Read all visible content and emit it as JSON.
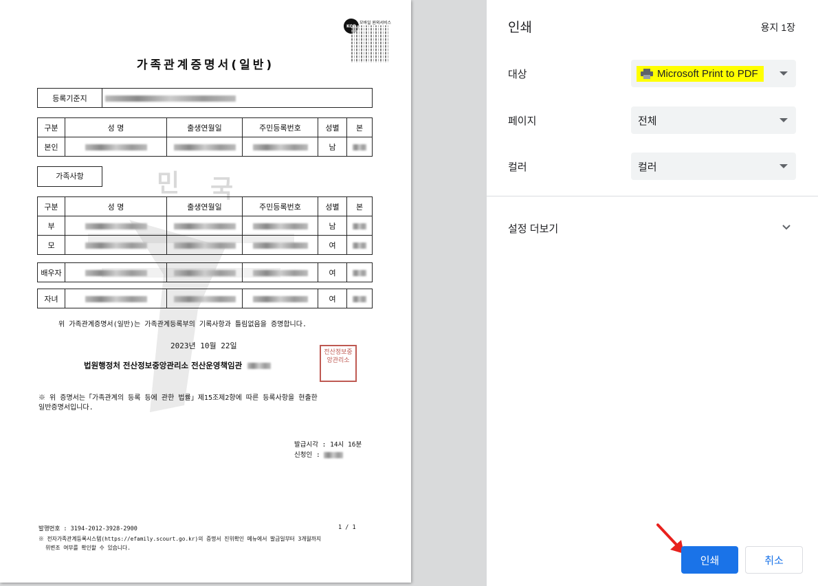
{
  "document": {
    "logo_text": "KOR",
    "service_label": "모바일 원외서비스",
    "title": "가족관계증명서(일반)",
    "registration_label": "등록기준지",
    "family_section_label": "가족사항",
    "headers": [
      "구분",
      "성 명",
      "출생연월일",
      "주민등록번호",
      "성별",
      "본"
    ],
    "self_row": {
      "kind": "본인",
      "gender": "남"
    },
    "family_rows": [
      {
        "kind": "부",
        "gender": "남"
      },
      {
        "kind": "모",
        "gender": "여"
      },
      {
        "kind": "배우자",
        "gender": "여"
      },
      {
        "kind": "자녀",
        "gender": "여"
      }
    ],
    "certify_text": "위 가족관계증명서(일반)는 가족관계등록부의 기록사항과 틀림없음을 증명합니다.",
    "date": "2023년 10월 22일",
    "issuer": "법원행정처 전산정보중앙관리소 전산운영책임관",
    "seal_text": "전산정보중앙관리소",
    "note_line1": "※ 위 증명서는「가족관계의 등록 등에 관한 법률」제15조제2항에 따른 등록사항을 현출한",
    "note_line2": "일반증명서입니다.",
    "issue_time": "발급시각 : 14시 16분",
    "applicant": "신청인 :",
    "issue_number": "발행번호 : 3194-2012-3928-2900",
    "page_number": "1  /  1",
    "footer_line1": "※ 전자가족관계등록시스템(https://efamily.scourt.go.kr)의 증명서 진위확인 메뉴에서 발급일부터 3개월까지",
    "footer_line2": "위변조 여부를 확인할 수 있습니다."
  },
  "panel": {
    "title": "인쇄",
    "sheets": "용지 1장",
    "destination_label": "대상",
    "destination_value": "Microsoft Print to PDF",
    "pages_label": "페이지",
    "pages_value": "전체",
    "color_label": "컬러",
    "color_value": "컬러",
    "more_settings": "설정 더보기",
    "print_button": "인쇄",
    "cancel_button": "취소"
  },
  "colors": {
    "accent": "#1a73e8",
    "highlight": "#ffff00",
    "arrow": "#e8211d",
    "seal": "#b8473f"
  }
}
